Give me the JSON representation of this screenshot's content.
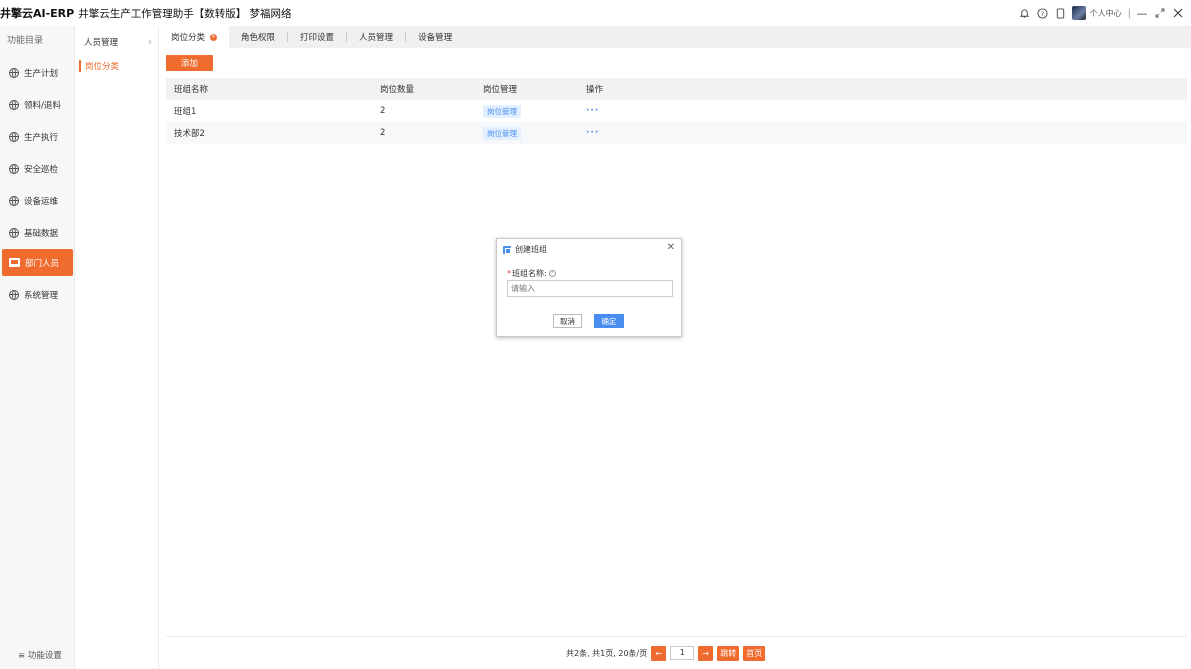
{
  "header": {
    "brand": "井擎云AI-ERP",
    "title": "井擎云生产工作管理助手【数转版】 梦福网络",
    "user_center": "个人中心"
  },
  "sidebar": {
    "heading": "功能目录",
    "items": [
      {
        "label": "生产计划"
      },
      {
        "label": "领料/退料"
      },
      {
        "label": "生产执行"
      },
      {
        "label": "安全巡检"
      },
      {
        "label": "设备运维"
      },
      {
        "label": "基础数据"
      },
      {
        "label": "部门人员",
        "active": true
      },
      {
        "label": "系统管理"
      }
    ],
    "bottom": "≡ 功能设置"
  },
  "subnav": {
    "heading": "人员管理",
    "active_item": "岗位分类"
  },
  "tabs": [
    {
      "label": "岗位分类",
      "active": true
    },
    {
      "label": "角色权限"
    },
    {
      "label": "打印设置"
    },
    {
      "label": "人员管理"
    },
    {
      "label": "设备管理"
    }
  ],
  "toolbar": {
    "add_label": "添加"
  },
  "table": {
    "columns": [
      "班组名称",
      "岗位数量",
      "岗位管理",
      "操作"
    ],
    "rows": [
      {
        "name": "班组1",
        "count": "2",
        "manage": "岗位管理",
        "ops": "···"
      },
      {
        "name": "技术部2",
        "count": "2",
        "manage": "岗位管理",
        "ops": "···"
      }
    ]
  },
  "pager": {
    "summary": "共2条, 共1页, 20条/页",
    "prev": "←",
    "page": "1",
    "next": "→",
    "jump": "跳转",
    "first": "首页"
  },
  "modal": {
    "title": "创建班组",
    "field_label": "班组名称:",
    "placeholder": "请输入",
    "cancel": "取消",
    "ok": "确定"
  },
  "colors": {
    "accent": "#ef6b2e",
    "primary": "#4a8df0"
  }
}
